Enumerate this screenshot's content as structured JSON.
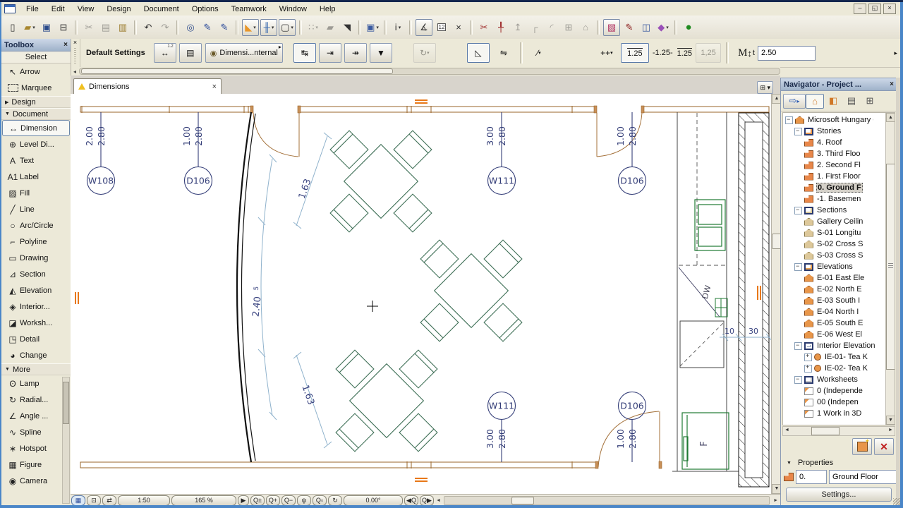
{
  "window": {
    "minimize": "–",
    "restore": "◱",
    "close": "×"
  },
  "menu": {
    "items": [
      "File",
      "Edit",
      "View",
      "Design",
      "Document",
      "Options",
      "Teamwork",
      "Window",
      "Help"
    ]
  },
  "toolbar": {
    "items": [
      {
        "i": "new-document-icon",
        "g": "▯"
      },
      {
        "i": "open-project-icon",
        "g": "▰",
        "c": true
      },
      {
        "i": "save-icon",
        "g": "▣"
      },
      {
        "i": "print-icon",
        "g": "⊟"
      },
      {
        "sep": true
      },
      {
        "i": "cut-icon",
        "g": "✂",
        "d": true
      },
      {
        "i": "copy-icon",
        "g": "▤",
        "d": true
      },
      {
        "i": "paste-icon",
        "g": "▥"
      },
      {
        "sep": true
      },
      {
        "i": "undo-icon",
        "g": "↶"
      },
      {
        "i": "redo-icon",
        "g": "↷",
        "d": true
      },
      {
        "sep": true
      },
      {
        "i": "find-select-icon",
        "g": "◎"
      },
      {
        "i": "pickup-parameters-icon",
        "g": "✎"
      },
      {
        "i": "inject-parameters-icon",
        "g": "✎"
      },
      {
        "sep": true
      },
      {
        "i": "guide-lines-icon",
        "g": "◣",
        "c": true,
        "b": true
      },
      {
        "i": "snap-guides-icon",
        "g": "╫",
        "c": true,
        "b": true
      },
      {
        "i": "cursor-snap-icon",
        "g": "▢",
        "c": true,
        "b": true
      },
      {
        "sep": true
      },
      {
        "i": "grid-display-icon",
        "g": "∷",
        "c": true,
        "d": true
      },
      {
        "i": "construction-line-icon",
        "g": "▰",
        "d": true
      },
      {
        "i": "arrow-segment-icon",
        "g": "◥"
      },
      {
        "sep": true
      },
      {
        "i": "layers-icon",
        "g": "▣",
        "c": true
      },
      {
        "sep": true
      },
      {
        "i": "column-display-icon",
        "g": "i",
        "c": true
      },
      {
        "sep": true
      },
      {
        "i": "measure-icon",
        "g": "∡",
        "b": true
      },
      {
        "i": "ruler-icon",
        "g": "12"
      },
      {
        "i": "stretch-icon",
        "g": "×"
      },
      {
        "sep": true
      },
      {
        "i": "trim-icon",
        "g": "✂"
      },
      {
        "i": "split-icon",
        "g": "╀"
      },
      {
        "i": "adjust-icon",
        "g": "↥",
        "d": true
      },
      {
        "i": "intersect-icon",
        "g": "┌",
        "d": true
      },
      {
        "i": "fillet-icon",
        "g": "◜",
        "d": true
      },
      {
        "i": "resize-icon",
        "g": "⊞",
        "d": true
      },
      {
        "i": "elevate-icon",
        "g": "⌂",
        "d": true
      },
      {
        "sep": true
      },
      {
        "i": "edit-selection-icon",
        "g": "▧",
        "b": true
      },
      {
        "i": "annotate-pen-icon",
        "g": "✎"
      },
      {
        "i": "favorites-icon",
        "g": "◫"
      },
      {
        "i": "virtual-trace-icon",
        "g": "◆",
        "c": true
      },
      {
        "sep": true
      },
      {
        "i": "teamwork-status-icon",
        "g": "●"
      }
    ]
  },
  "infobox": {
    "close": "×",
    "default_settings": "Default Settings",
    "dim_glyph": "↔",
    "dim_badge": "1.2",
    "layers_glyph": "▤",
    "eye_glyph": "◉",
    "visibility_label": "Dimensi...nternal",
    "witness": [
      {
        "i": "witness-custom-icon",
        "g": "↹",
        "sel": true
      },
      {
        "i": "witness-gap-icon",
        "g": "⇥"
      },
      {
        "i": "witness-none-icon",
        "g": "↠"
      },
      {
        "i": "witness-marker-icon",
        "g": "▼"
      }
    ],
    "rotate_glyph": "↻",
    "angle_glyph": "◺",
    "flip_glyph": "⇋",
    "line_glyph": "∕",
    "marker_glyph": "++",
    "val_a": "1.25",
    "val_b": "-1.25-",
    "val_c": "1.25",
    "val_d": "1,25",
    "mt_m": "M",
    "mt_arrow": "↕",
    "mt_t": "t",
    "mt_value": "2.50",
    "overflow": "▸",
    "scroll_left": "◂"
  },
  "toolbox": {
    "title": "Toolbox",
    "close": "×",
    "select": "Select",
    "design": "Design",
    "document": "Document",
    "more": "More",
    "select_items": [
      {
        "icon": "arrow-tool-icon",
        "g": "↖",
        "label": "Arrow"
      },
      {
        "icon": "marquee-tool-icon",
        "g": "",
        "label": "Marquee"
      }
    ],
    "document_items": [
      {
        "icon": "dimension-tool-icon",
        "g": "↔",
        "label": "Dimension",
        "sel": true
      },
      {
        "icon": "level-dimension-tool-icon",
        "g": "⊕",
        "label": "Level Di..."
      },
      {
        "icon": "text-tool-icon",
        "g": "A",
        "label": "Text"
      },
      {
        "icon": "label-tool-icon",
        "g": "A1",
        "label": "Label"
      },
      {
        "icon": "fill-tool-icon",
        "g": "▨",
        "label": "Fill"
      },
      {
        "icon": "line-tool-icon",
        "g": "╱",
        "label": "Line"
      },
      {
        "icon": "arc-circle-tool-icon",
        "g": "○",
        "label": "Arc/Circle"
      },
      {
        "icon": "polyline-tool-icon",
        "g": "⌐",
        "label": "Polyline"
      },
      {
        "icon": "drawing-tool-icon",
        "g": "▭",
        "label": "Drawing"
      },
      {
        "icon": "section-tool-icon",
        "g": "⊿",
        "label": "Section"
      },
      {
        "icon": "elevation-tool-icon",
        "g": "◭",
        "label": "Elevation"
      },
      {
        "icon": "interior-elevation-tool-icon",
        "g": "◈",
        "label": "Interior..."
      },
      {
        "icon": "worksheet-tool-icon",
        "g": "◪",
        "label": "Worksh..."
      },
      {
        "icon": "detail-tool-icon",
        "g": "◳",
        "label": "Detail"
      },
      {
        "icon": "change-tool-icon",
        "g": "◕",
        "label": "Change"
      }
    ],
    "more_items": [
      {
        "icon": "lamp-tool-icon",
        "g": "ʘ",
        "label": "Lamp"
      },
      {
        "icon": "radial-dimension-tool-icon",
        "g": "↻",
        "label": "Radial..."
      },
      {
        "icon": "angle-dimension-tool-icon",
        "g": "∠",
        "label": "Angle ..."
      },
      {
        "icon": "spline-tool-icon",
        "g": "∿",
        "label": "Spline"
      },
      {
        "icon": "hotspot-tool-icon",
        "g": "∗",
        "label": "Hotspot"
      },
      {
        "icon": "figure-tool-icon",
        "g": "▦",
        "label": "Figure"
      },
      {
        "icon": "camera-tool-icon",
        "g": "◉",
        "label": "Camera"
      }
    ]
  },
  "tabbar": {
    "tab_label": "Dimensions",
    "tab_close": "×"
  },
  "plan": {
    "markers": {
      "w108": "W108",
      "d106a": "D106",
      "w111a": "W111",
      "d106b": "D106",
      "w111b": "W111",
      "d106c": "D106"
    },
    "dims": {
      "w108": [
        "2.00",
        "2.80"
      ],
      "d106a": [
        "1.00",
        "2.80"
      ],
      "w111a": [
        "3.00",
        "2.80"
      ],
      "d106b": [
        "1.00",
        "2.80"
      ],
      "w111b": [
        "3.00",
        "2.80"
      ],
      "d106c": [
        "1.00",
        "2.80"
      ]
    },
    "arc": {
      "top": "1.63",
      "mid_main": "2.40",
      "mid_sup": "5",
      "bottom": "1.63"
    },
    "kitchen": {
      "dw": "DW",
      "fridge": "F",
      "d10": "10",
      "d30": "30"
    }
  },
  "statusbar": {
    "scale": "1:50",
    "zoom": "165 %",
    "angle": "0.00°",
    "btns": [
      {
        "i": "quick-options-icon",
        "g": "▦"
      },
      {
        "i": "preview-mode-icon",
        "g": "⊡"
      },
      {
        "i": "refresh-icon",
        "g": "⇄"
      }
    ],
    "expander": "▶",
    "zbtns": [
      {
        "i": "zoom-adjust-icon",
        "g": "Q±"
      },
      {
        "i": "zoom-in-icon",
        "g": "Q+"
      },
      {
        "i": "zoom-out-icon",
        "g": "Q−"
      },
      {
        "i": "pan-icon",
        "g": "ψ"
      },
      {
        "i": "fit-in-window-icon",
        "g": "Q▫"
      },
      {
        "i": "rotate-view-icon",
        "g": "↻"
      }
    ],
    "navz": [
      {
        "i": "previous-view-icon",
        "g": "◀Q"
      },
      {
        "i": "next-view-icon",
        "g": "Q▶"
      }
    ],
    "scroll_left": "◄",
    "scroll_right": "►"
  },
  "navigator": {
    "title": "Navigator - Project ...",
    "close": "×",
    "toolbar": [
      {
        "i": "project-chooser-icon",
        "g": "⇨",
        "c": true
      },
      {
        "i": "floor-plan-view-icon",
        "g": "⌂",
        "sel": true
      },
      {
        "i": "section-view-icon",
        "g": "◧"
      },
      {
        "i": "layout-book-icon",
        "g": "▤"
      },
      {
        "i": "3d-view-icon",
        "g": "⊞"
      }
    ],
    "tree": [
      {
        "l": "Microsoft Hungary O",
        "i": "project-icon",
        "lv": 0,
        "e": "minus"
      },
      {
        "l": "Stories",
        "i": "stories-icon",
        "lv": 1,
        "e": "minus"
      },
      {
        "l": "4. Roof",
        "i": "story-icon",
        "lv": 2,
        "e": "none"
      },
      {
        "l": "3. Third Floo",
        "i": "story-icon",
        "lv": 2,
        "e": "none"
      },
      {
        "l": "2. Second Fl",
        "i": "story-icon",
        "lv": 2,
        "e": "none"
      },
      {
        "l": "1. First Floor",
        "i": "story-icon",
        "lv": 2,
        "e": "none"
      },
      {
        "l": "0. Ground F",
        "i": "story-icon",
        "lv": 2,
        "e": "none",
        "sel": true
      },
      {
        "l": "-1. Basemen",
        "i": "story-icon",
        "lv": 2,
        "e": "none"
      },
      {
        "l": "Sections",
        "i": "sections-icon",
        "lv": 1,
        "e": "minus"
      },
      {
        "l": "Gallery Ceilin",
        "i": "section-icon",
        "lv": 2,
        "e": "none"
      },
      {
        "l": "S-01 Longitu",
        "i": "section-icon",
        "lv": 2,
        "e": "none"
      },
      {
        "l": "S-02 Cross S",
        "i": "section-icon",
        "lv": 2,
        "e": "none"
      },
      {
        "l": "S-03 Cross S",
        "i": "section-icon",
        "lv": 2,
        "e": "none"
      },
      {
        "l": "Elevations",
        "i": "elevations-icon",
        "lv": 1,
        "e": "minus"
      },
      {
        "l": "E-01 East Ele",
        "i": "elevation-icon",
        "lv": 2,
        "e": "none"
      },
      {
        "l": "E-02 North E",
        "i": "elevation-icon",
        "lv": 2,
        "e": "none"
      },
      {
        "l": "E-03 South I",
        "i": "elevation-icon",
        "lv": 2,
        "e": "none"
      },
      {
        "l": "E-04 North I",
        "i": "elevation-icon",
        "lv": 2,
        "e": "none"
      },
      {
        "l": "E-05 South E",
        "i": "elevation-icon",
        "lv": 2,
        "e": "none"
      },
      {
        "l": "E-06 West El",
        "i": "elevation-icon",
        "lv": 2,
        "e": "none"
      },
      {
        "l": "Interior Elevation",
        "i": "interior-icon",
        "lv": 1,
        "e": "minus"
      },
      {
        "l": "IE-01- Tea K",
        "i": "ie-icon",
        "lv": 2,
        "e": "plus"
      },
      {
        "l": "IE-02- Tea K",
        "i": "ie-icon",
        "lv": 2,
        "e": "plus"
      },
      {
        "l": "Worksheets",
        "i": "worksheets-icon",
        "lv": 1,
        "e": "minus"
      },
      {
        "l": "0 (Independe",
        "i": "worksheet-icon",
        "lv": 2,
        "e": "none"
      },
      {
        "l": "00 (Indepen",
        "i": "worksheet-icon",
        "lv": 2,
        "e": "none"
      },
      {
        "l": "1 Work in 3D",
        "i": "worksheet-icon",
        "lv": 2,
        "e": "none"
      }
    ],
    "properties_label": "Properties",
    "story_no": "0.",
    "story_name": "Ground Floor",
    "settings_label": "Settings..."
  }
}
